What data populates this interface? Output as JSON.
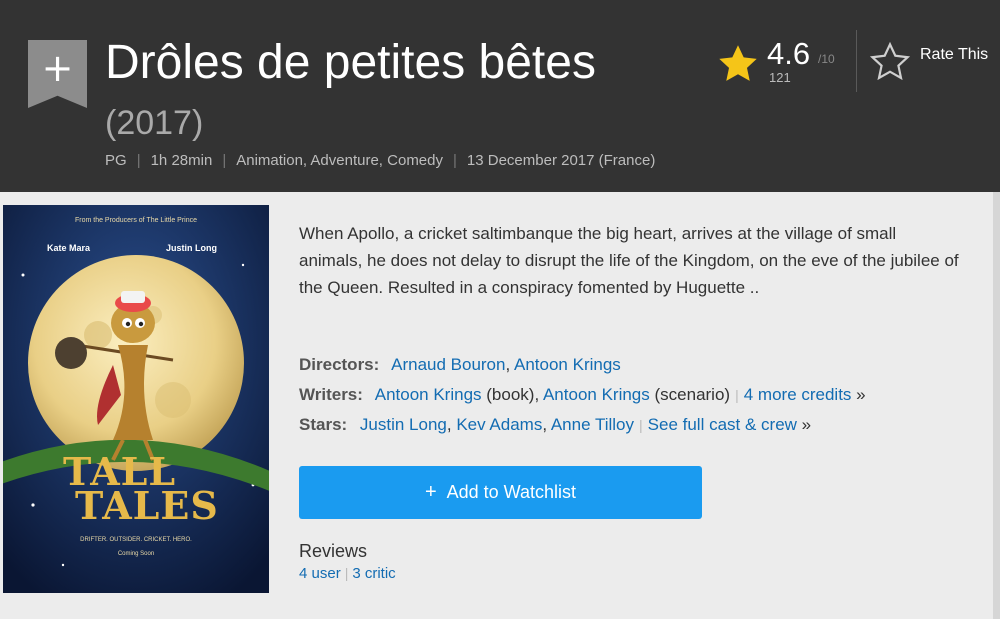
{
  "header": {
    "title": "Drôles de petites bêtes",
    "year": "(2017)",
    "meta": [
      "PG",
      "1h 28min",
      "Animation, Adventure, Comedy",
      "13 December 2017 (France)"
    ],
    "add_icon": "plus-icon",
    "rating": {
      "value": "4.6",
      "out_of": "/10",
      "count": "121",
      "icon": "star-filled-icon"
    },
    "rate_this": {
      "label": "Rate This",
      "icon": "star-outline-icon"
    }
  },
  "poster": {
    "top_line": "From the Producers of The Little Prince",
    "actor_left": "Kate Mara",
    "actor_right": "Justin Long",
    "title_line1": "TALL",
    "title_line2": "TALES",
    "tagline": "DRIFTER. OUTSIDER. CRICKET. HERO.",
    "coming": "Coming Soon"
  },
  "plot": "When Apollo, a cricket saltimbanque the big heart, arrives at the village of small animals, he does not delay to disrupt the life of the Kingdom, on the eve of the jubilee of the Queen. Resulted in a conspiracy fomented by Huguette ..",
  "credits": {
    "directors": {
      "label": "Directors:",
      "names": [
        "Arnaud Bouron",
        "Antoon Krings"
      ]
    },
    "writers": {
      "label": "Writers:",
      "name1": "Antoon Krings",
      "role1": "(book)",
      "name2": "Antoon Krings",
      "role2": "(scenario)",
      "more": "4 more credits"
    },
    "stars": {
      "label": "Stars:",
      "names": [
        "Justin Long",
        "Kev Adams",
        "Anne Tilloy"
      ],
      "more": "See full cast & crew"
    }
  },
  "watchlist": {
    "plus": "+",
    "label": "Add to Watchlist"
  },
  "reviews": {
    "heading": "Reviews",
    "user": "4 user",
    "critic": "3 critic"
  },
  "colors": {
    "header_bg": "#333333",
    "accent_link": "#136cb2",
    "button": "#1a9bf0",
    "star": "#f5c518"
  }
}
